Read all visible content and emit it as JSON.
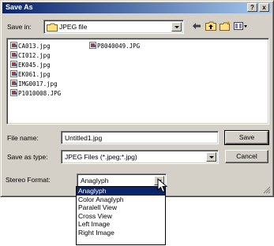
{
  "window": {
    "title": "Save As",
    "help_button": "?",
    "close_button": "x"
  },
  "savein": {
    "label": "Save in:",
    "value": "JPEG file"
  },
  "toolbar": {
    "icons": [
      "back-arrow-icon",
      "up-folder-icon",
      "new-folder-icon",
      "view-menu-icon"
    ]
  },
  "files": {
    "col1": [
      "CA013.jpg",
      "CI012.jpg",
      "EK045.jpg",
      "EK061.jpg",
      "IMG0017.jpg",
      "P1010008.JPG"
    ],
    "col2": [
      "P8040049.JPG"
    ]
  },
  "filename": {
    "label": "File name:",
    "value": "Untitled1.jpg"
  },
  "savetype": {
    "label": "Save as type:",
    "value": "JPEG Files (*.jpeg;*.jpg)"
  },
  "buttons": {
    "save": "Save",
    "cancel": "Cancel"
  },
  "stereo": {
    "label": "Stereo Format:",
    "value": "Anaglyph",
    "options": [
      "Anaglyph",
      "Color Anaglyph",
      "Paralell View",
      "Cross View",
      "Left Image",
      "Right Image"
    ]
  },
  "colors": {
    "title_start": "#0a246a",
    "title_end": "#a6caf0",
    "face": "#d4d0c8",
    "selection": "#0a246a"
  }
}
